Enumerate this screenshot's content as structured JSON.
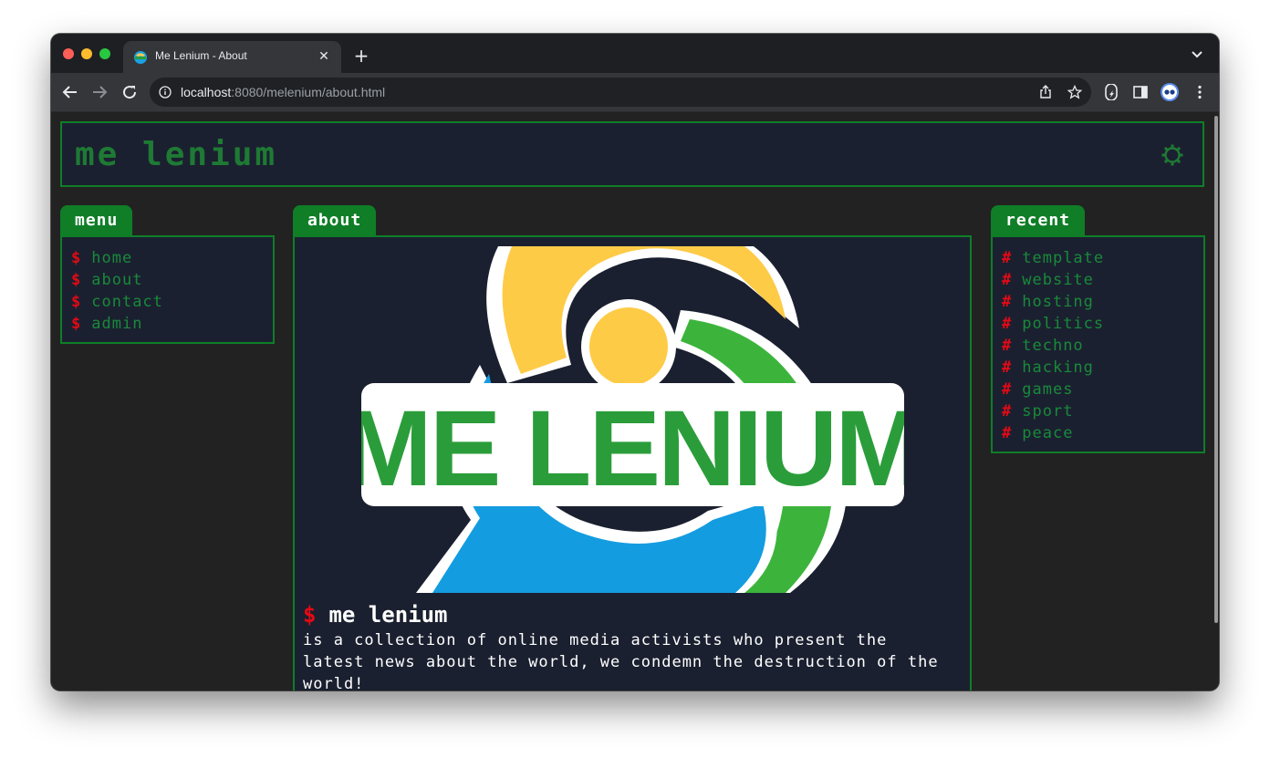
{
  "browser": {
    "tab_title": "Me Lenium - About",
    "url_host": "localhost",
    "url_rest": ":8080/melenium/about.html"
  },
  "site": {
    "title": "Me Lenium"
  },
  "menu": {
    "label": "Menu",
    "items": [
      {
        "mark": "$",
        "label": "Home"
      },
      {
        "mark": "$",
        "label": "About"
      },
      {
        "mark": "$",
        "label": "Contact"
      },
      {
        "mark": "$",
        "label": "Admin"
      }
    ]
  },
  "about": {
    "label": "About",
    "logo_text": "ME LENIUM",
    "heading_mark": "$",
    "heading": "Me Lenium",
    "text": "is a collection of online media activists who present the latest news about the world, we condemn the destruction of the world!"
  },
  "recent": {
    "label": "Recent",
    "items": [
      {
        "mark": "#",
        "label": "Template"
      },
      {
        "mark": "#",
        "label": "Website"
      },
      {
        "mark": "#",
        "label": "Hosting"
      },
      {
        "mark": "#",
        "label": "Politics"
      },
      {
        "mark": "#",
        "label": "Techno"
      },
      {
        "mark": "#",
        "label": "Hacking"
      },
      {
        "mark": "#",
        "label": "Games"
      },
      {
        "mark": "#",
        "label": "Sport"
      },
      {
        "mark": "#",
        "label": "Peace"
      }
    ]
  },
  "colors": {
    "accent_green": "#0f7e27",
    "link_green": "#188a3a",
    "mark_red": "#e50914",
    "panel_bg": "#1b2030",
    "page_bg": "#222222"
  }
}
